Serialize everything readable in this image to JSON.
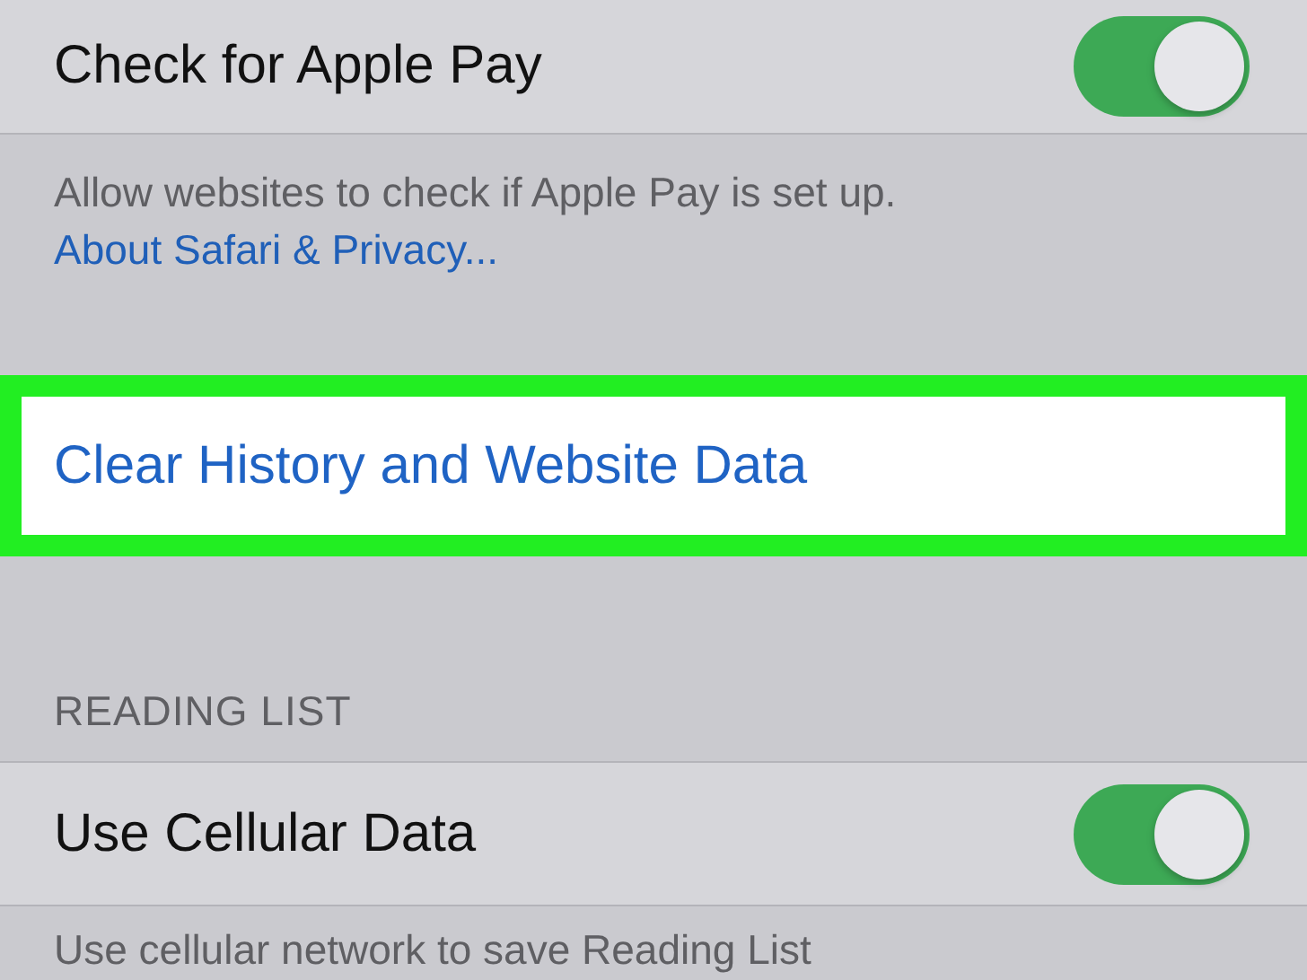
{
  "apple_pay": {
    "label": "Check for Apple Pay",
    "on": true
  },
  "apple_pay_footer": {
    "text": "Allow websites to check if Apple Pay is set up.",
    "link": "About Safari & Privacy..."
  },
  "clear_history": {
    "label": "Clear History and Website Data",
    "highlighted": true
  },
  "reading_list": {
    "header": "READING LIST",
    "cellular": {
      "label": "Use Cellular Data",
      "on": true
    },
    "footer": "Use cellular network to save Reading List"
  }
}
